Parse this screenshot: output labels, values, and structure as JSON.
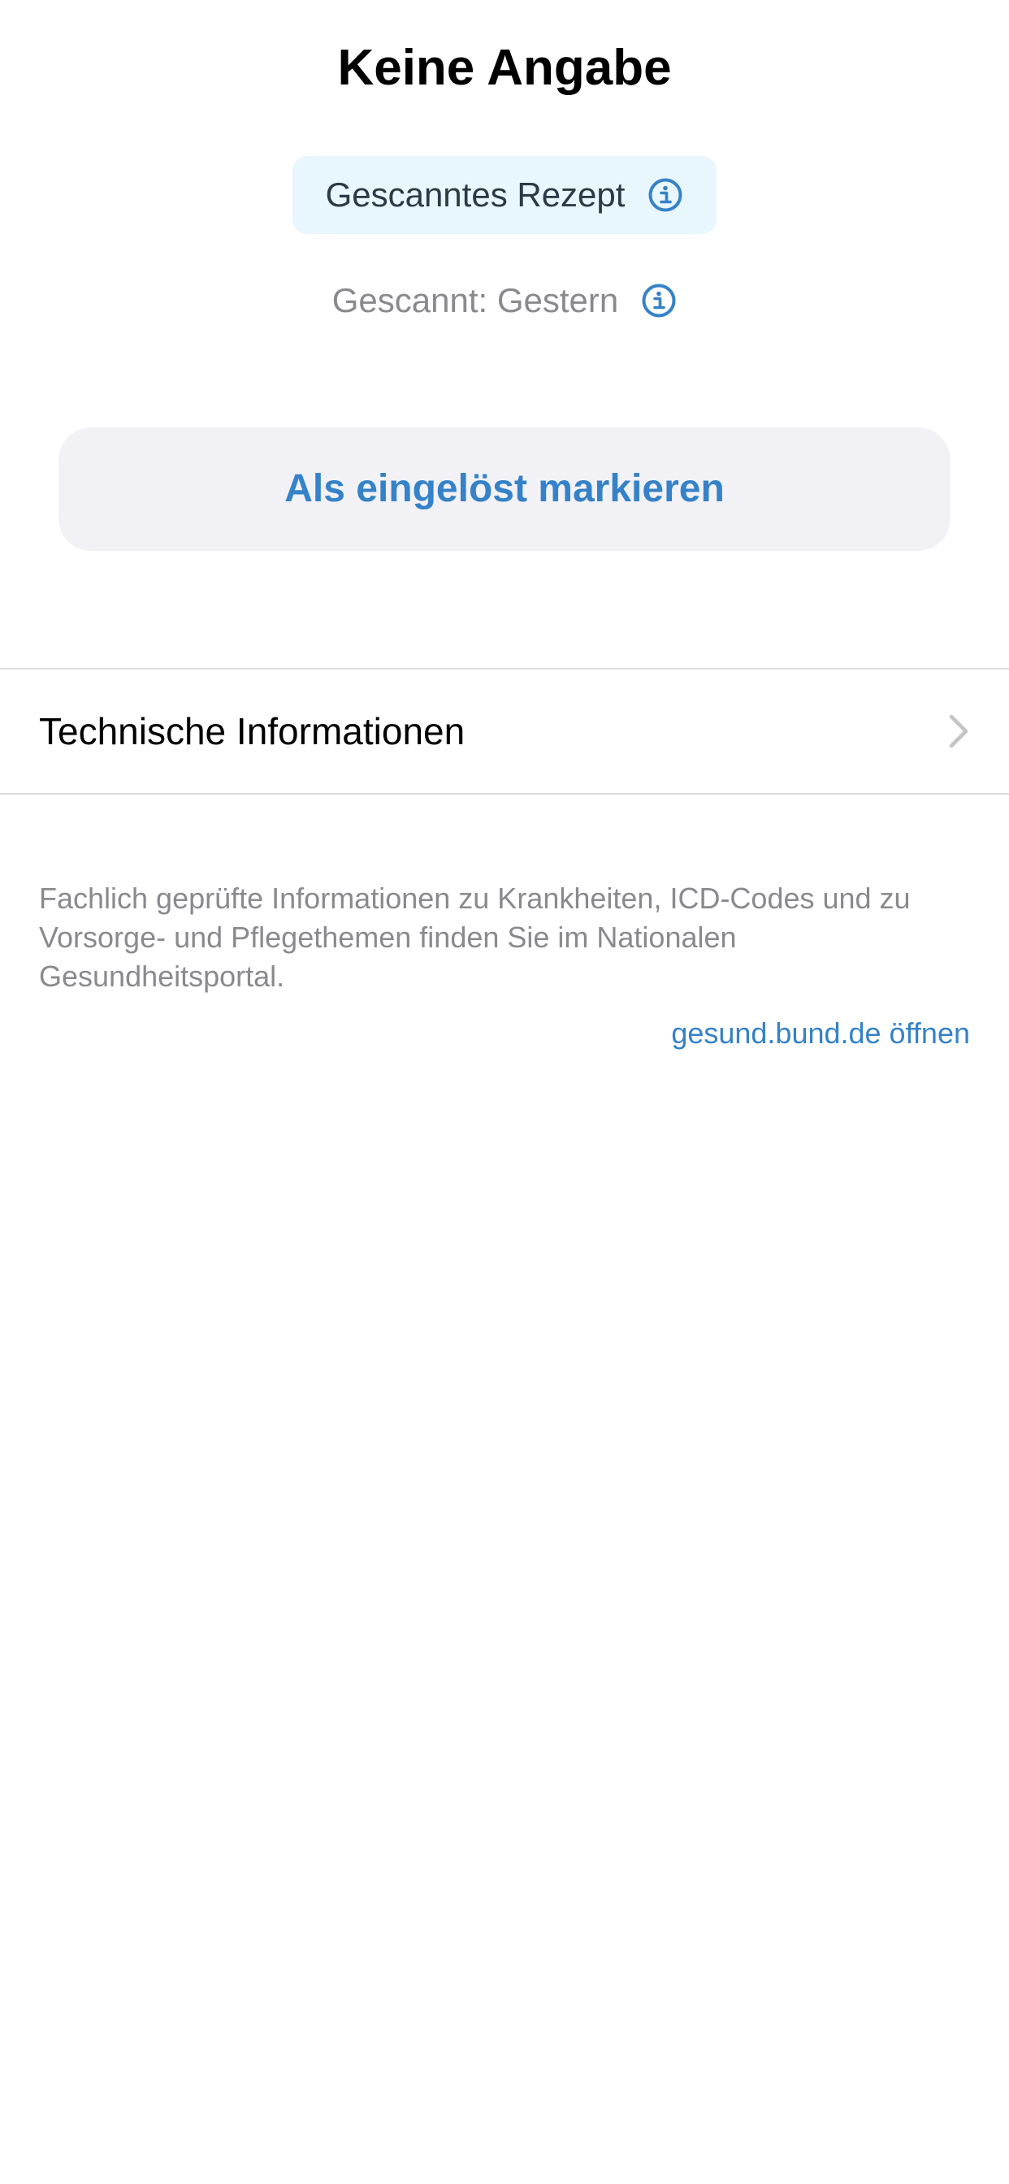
{
  "header": {
    "title": "Keine Angabe"
  },
  "prescription": {
    "type_label": "Gescanntes Rezept",
    "scanned_label": "Gescannt: Gestern"
  },
  "actions": {
    "redeem_label": "Als eingelöst markieren"
  },
  "technical": {
    "label": "Technische Informationen"
  },
  "footer": {
    "text": "Fachlich geprüfte Informationen zu Krankheiten, ICD-Codes und zu Vorsorge- und Pflegethemen finden Sie im Nationalen Gesundheitsportal.",
    "link_label": "gesund.bund.de öffnen"
  },
  "icons": {
    "type_info": "info-icon",
    "scanned_info": "info-icon",
    "technical_chevron": "chevron-right-icon"
  },
  "colors": {
    "accent": "#3582c8",
    "chip_background": "#e8f6fe",
    "button_background": "#f2f2f6",
    "secondary_text": "#8a8a8e",
    "divider": "#dcdcde"
  }
}
